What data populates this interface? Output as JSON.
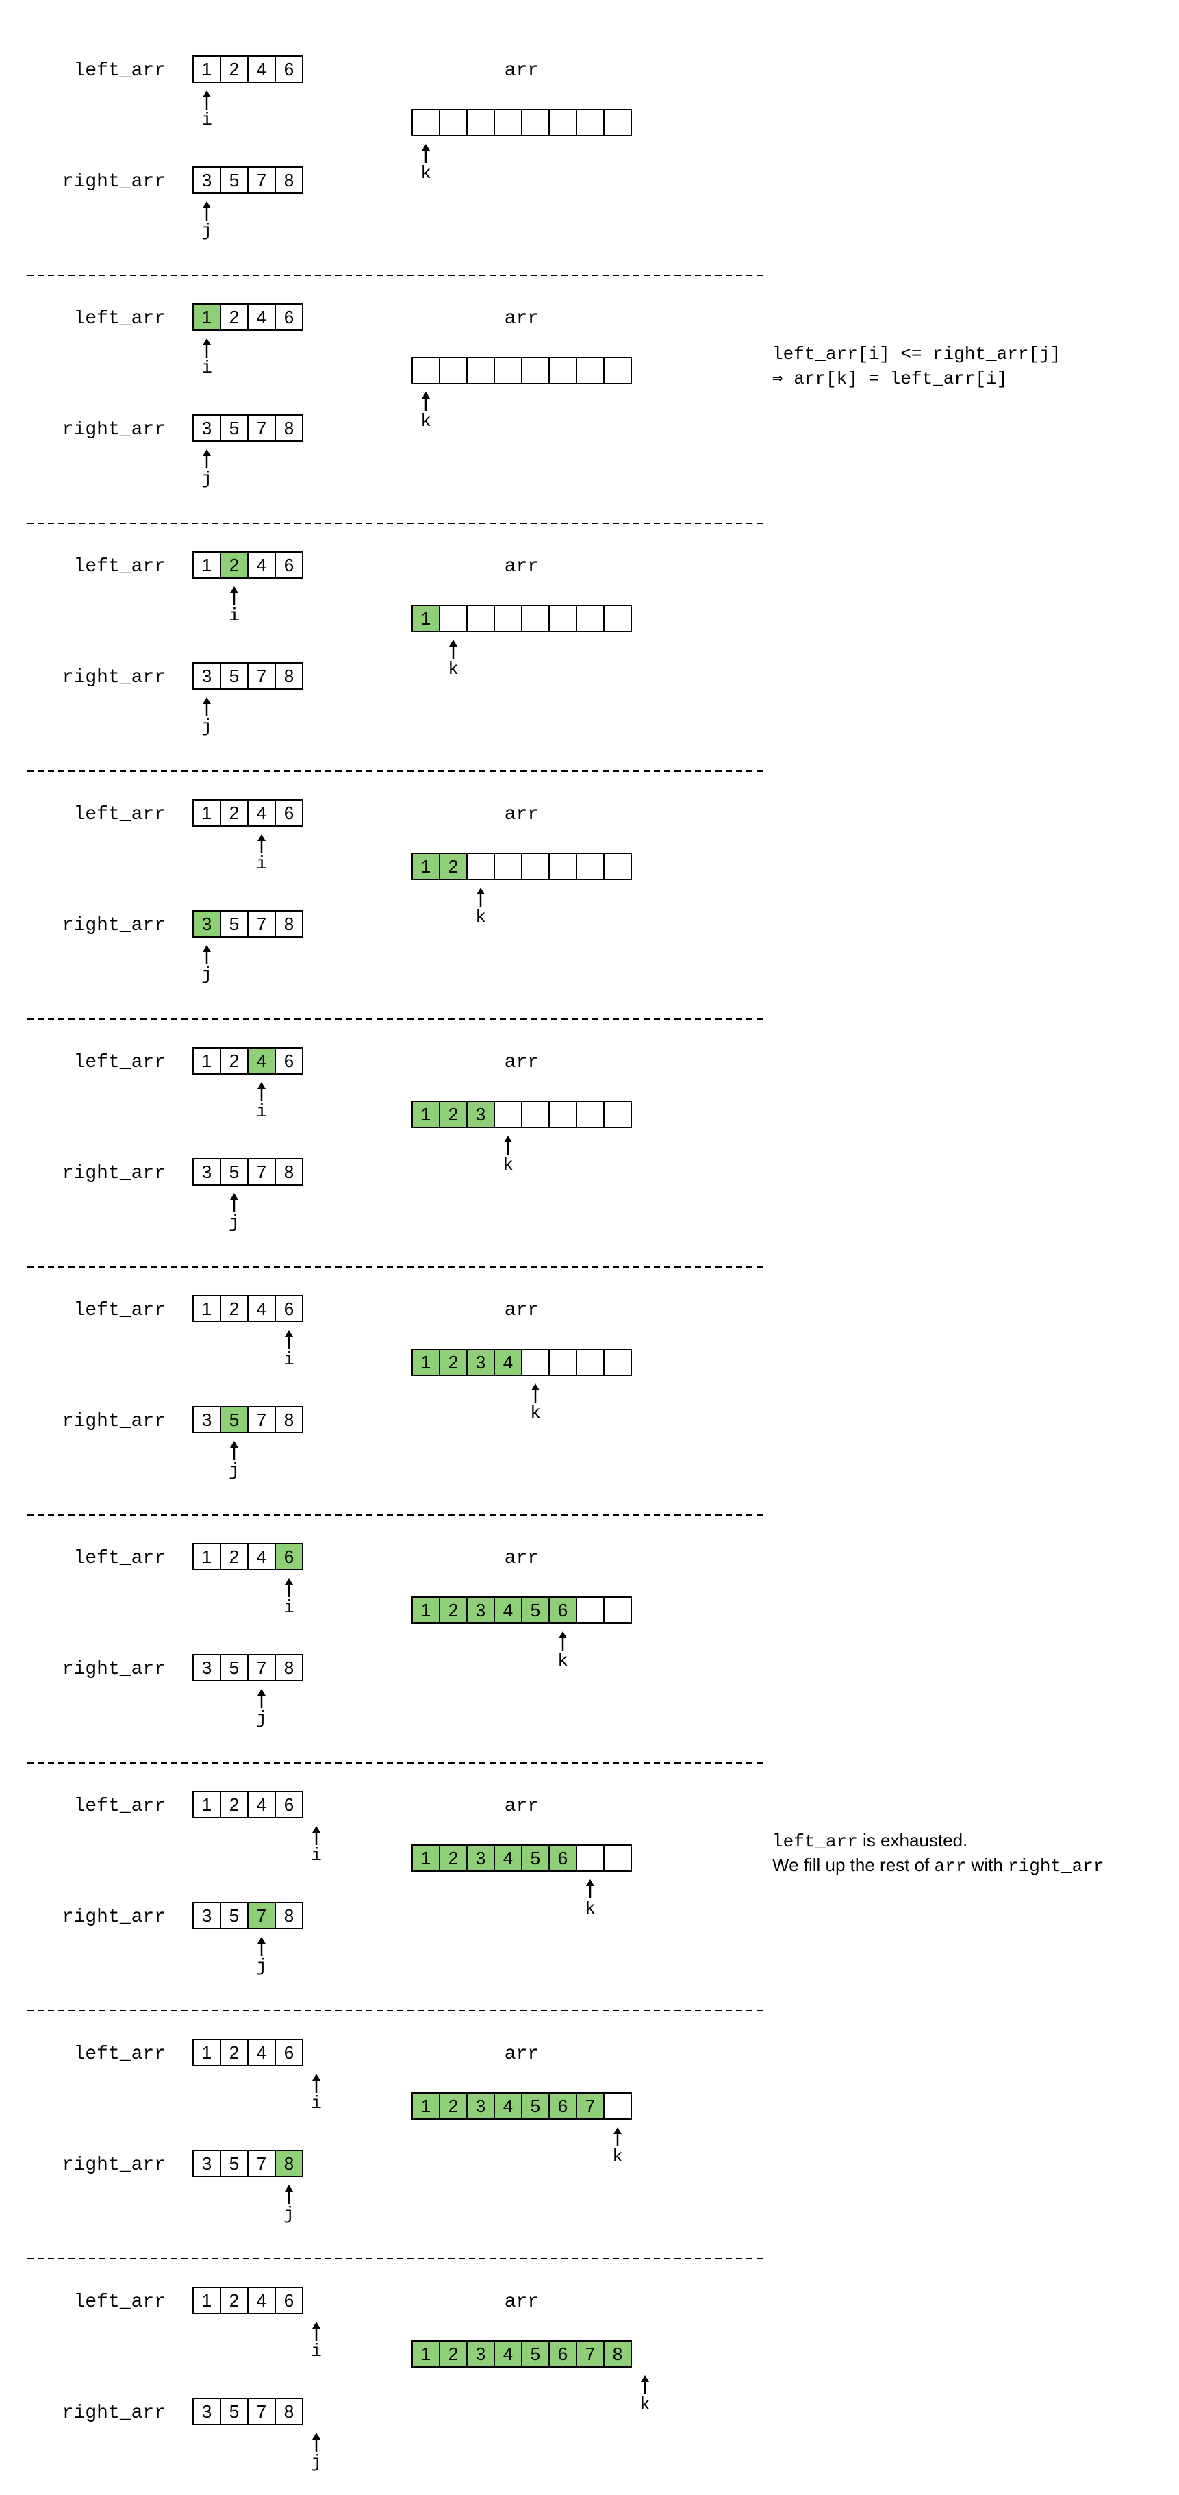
{
  "labels": {
    "left": "left_arr",
    "right": "right_arr",
    "arr": "arr",
    "i": "i",
    "j": "j",
    "k": "k"
  },
  "left_arr": [
    "1",
    "2",
    "4",
    "6"
  ],
  "right_arr": [
    "3",
    "5",
    "7",
    "8"
  ],
  "arr_size": 8,
  "highlight_color": "#8fcf78",
  "steps": [
    {
      "i": 0,
      "j": 0,
      "k": 0,
      "left_hl": null,
      "right_hl": null,
      "arr": []
    },
    {
      "i": 0,
      "j": 0,
      "k": 0,
      "left_hl": 0,
      "right_hl": null,
      "arr": []
    },
    {
      "i": 1,
      "j": 0,
      "k": 1,
      "left_hl": 1,
      "right_hl": null,
      "arr": [
        "1"
      ]
    },
    {
      "i": 2,
      "j": 0,
      "k": 2,
      "left_hl": null,
      "right_hl": 0,
      "arr": [
        "1",
        "2"
      ]
    },
    {
      "i": 2,
      "j": 1,
      "k": 3,
      "left_hl": 2,
      "right_hl": null,
      "arr": [
        "1",
        "2",
        "3"
      ]
    },
    {
      "i": 3,
      "j": 1,
      "k": 4,
      "left_hl": null,
      "right_hl": 1,
      "arr": [
        "1",
        "2",
        "3",
        "4"
      ]
    },
    {
      "i": 3,
      "j": 2,
      "k": 5,
      "left_hl": 3,
      "right_hl": null,
      "arr": [
        "1",
        "2",
        "3",
        "4",
        "5",
        "6"
      ]
    },
    {
      "i": 4,
      "j": 2,
      "k": 6,
      "left_hl": null,
      "right_hl": 2,
      "arr": [
        "1",
        "2",
        "3",
        "4",
        "5",
        "6"
      ]
    },
    {
      "i": 4,
      "j": 3,
      "k": 7,
      "left_hl": null,
      "right_hl": 3,
      "arr": [
        "1",
        "2",
        "3",
        "4",
        "5",
        "6",
        "7"
      ]
    },
    {
      "i": 4,
      "j": 4,
      "k": 8,
      "left_hl": null,
      "right_hl": null,
      "arr": [
        "1",
        "2",
        "3",
        "4",
        "5",
        "6",
        "7",
        "8"
      ]
    }
  ],
  "annotations": [
    {
      "step": 1,
      "style": "code",
      "lines": [
        "left_arr[i] <= right_arr[j]",
        "⇒ arr[k] = left_arr[i]"
      ]
    },
    {
      "step": 7,
      "style": "mixed",
      "lines": [
        [
          {
            "t": "left_arr",
            "code": true
          },
          {
            "t": " is exhausted.",
            "code": false
          }
        ],
        [
          {
            "t": "We fill up the rest of ",
            "code": false
          },
          {
            "t": "arr",
            "code": true
          },
          {
            "t": " with ",
            "code": false
          },
          {
            "t": "right_arr",
            "code": true
          }
        ]
      ]
    }
  ]
}
